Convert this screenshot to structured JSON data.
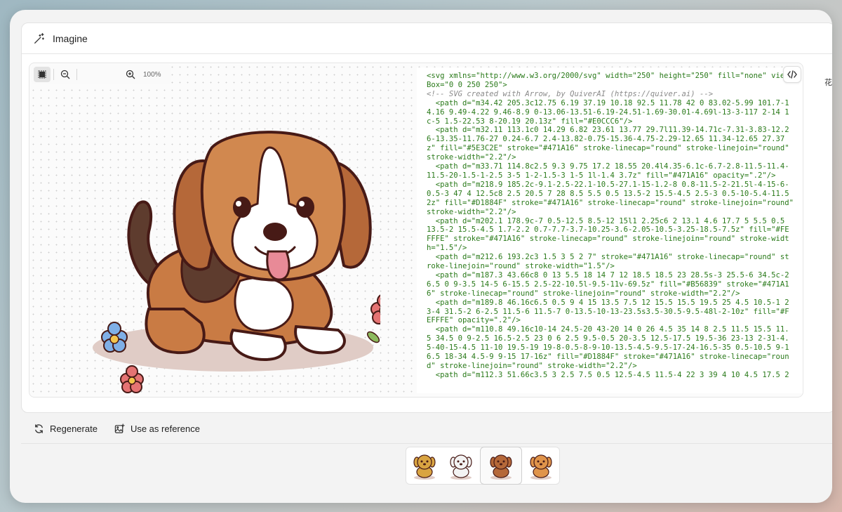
{
  "header": {
    "title": "Imagine",
    "icon": "magic-wand-icon"
  },
  "toolbar": {
    "zoom": "100%"
  },
  "side_label": "花",
  "code_lines": [
    "<svg xmlns=\"http://www.w3.org/2000/svg\" width=\"250\" height=\"250\" fill=\"none\" view",
    "Box=\"0 0 250 250\">",
    "<!-- SVG created with Arrow, by QuiverAI (https://quiver.ai) -->",
    "  <path d=\"m34.42 205.3c12.75 6.19 37.19 10.18 92.5 11.78 42 0 83.02-5.99 101.7-1",
    "4.16 9.49-4.22 9.46-8.9 0-13.06-13.51-6.19-24.51-1.69-30.01-4.69l-13-3-117 2-14 1",
    "c-5 1.5-22.53 8-20.19 20.13z\" fill=\"#E0CCC6\"/>",
    "  <path d=\"m32.11 113.1c0 14.29 6.82 23.61 13.77 29.7l11.39-14.71c-7.31-3.83-12.2",
    "6-13.35-11.76-27 0.24-6.7 2.4-13.82-0.75-15.36-4.75-2.29-12.65 11.34-12.65 27.37",
    "z\" fill=\"#5E3C2E\" stroke=\"#471A16\" stroke-linecap=\"round\" stroke-linejoin=\"round\"",
    "stroke-width=\"2.2\"/>",
    "  <path d=\"m33.71 114.8c2.5 9.3 9.75 17.2 18.55 20.4l4.35-6.1c-6.7-2.8-11.5-11.4-",
    "11.5-20-1.5-1-2.5 3-5 1-2-1.5-3 1-5 1l-1.4 3.7z\" fill=\"#471A16\" opacity=\".2\"/>",
    "  <path d=\"m218.9 185.2c-9.1-2.5-22.1-10.5-27.1-15-1.2-8 0.8-11.5-2-21.5l-4-15-6-",
    "0.5-3 47 4 12.5c8 2.5 20.5 7 28 8.5 5.5 0.5 13.5-2 15.5-4.5 2.5-3 0.5-10-5.4-11.5",
    "2z\" fill=\"#D1884F\" stroke=\"#471A16\" stroke-linecap=\"round\" stroke-linejoin=\"round\"",
    "stroke-width=\"2.2\"/>",
    "  <path d=\"m202.1 178.9c-7 0.5-12.5 8.5-12 15l1 2.25c6 2 13.1 4.6 17.7 5 5.5 0.5",
    "13.5-2 15.5-4.5 1.7-2.2 0.7-7.7-3.7-10.25-3.6-2.05-10.5-3.25-18.5-7.5z\" fill=\"#FE",
    "FFFE\" stroke=\"#471A16\" stroke-linecap=\"round\" stroke-linejoin=\"round\" stroke-widt",
    "h=\"1.5\"/>",
    "  <path d=\"m212.6 193.2c3 1.5 3 5 2 7\" stroke=\"#471A16\" stroke-linecap=\"round\" st",
    "roke-linejoin=\"round\" stroke-width=\"1.5\"/>",
    "  <path d=\"m187.3 43.66c8 0 13 5.5 18 14 7 12 18.5 18.5 23 28.5s-3 25.5-6 34.5c-2",
    "6.5 0 9-3.5 14-5 6-15.5 2.5-22-10.5l-9.5-11v-69.5z\" fill=\"#B56839\" stroke=\"#471A1",
    "6\" stroke-linecap=\"round\" stroke-linejoin=\"round\" stroke-width=\"2.2\"/>",
    "  <path d=\"m189.8 46.16c6.5 0.5 9 4 15 13.5 7.5 12 15.5 15.5 19.5 25 4.5 10.5-1 2",
    "3-4 31.5-2 6-2.5 11.5-6 11.5-7 0-13.5-10-13-23.5s3.5-30.5-9.5-48l-2-10z\" fill=\"#F",
    "EFFFE\" opacity=\".2\"/>",
    "  <path d=\"m110.8 49.16c10-14 24.5-20 43-20 14 0 26 4.5 35 14 8 2.5 11.5 15.5 11.",
    "5 34.5 0 9-2.5 16.5-2.5 23 0 6 2.5 9.5-0.5 20-3.5 12.5-17.5 19.5-36 23-13 2-31-4.",
    "5-40-15-4.5 11-10 19.5-19 19-8-0.5-8-9-10-13.5-4.5-9.5-17-24-16.5-35 0.5-10.5 9-1",
    "6.5 18-34 4.5-9 9-15 17-16z\" fill=\"#D1884F\" stroke=\"#471A16\" stroke-linecap=\"roun",
    "d\" stroke-linejoin=\"round\" stroke-width=\"2.2\"/>",
    "  <path d=\"m112.3 51.66c3.5 3 2.5 7.5 0.5 12.5-4.5 11.5-4 22 3 39 4 10 4.5 17.5 2"
  ],
  "actions": {
    "regenerate": "Regenerate",
    "use_reference": "Use as reference"
  },
  "thumbnails": [
    {
      "name": "golden-puppy",
      "color": "#d9a441",
      "selected": false
    },
    {
      "name": "white-puppy",
      "color": "#f3f3f3",
      "selected": false
    },
    {
      "name": "beagle-puppy",
      "color": "#b56839",
      "selected": true
    },
    {
      "name": "corgi-puppy",
      "color": "#e0944a",
      "selected": false
    }
  ],
  "colors": {
    "dog_brown": "#C97B44",
    "dog_dark": "#5E3C2E",
    "outline": "#471A16",
    "shadow": "#E0CCC6",
    "tongue": "#E88A97"
  }
}
